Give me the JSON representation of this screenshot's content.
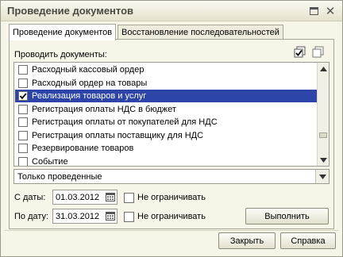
{
  "window": {
    "title": "Проведение документов"
  },
  "tabs": [
    {
      "label": "Проведение документов"
    },
    {
      "label": "Восстановление последовательностей"
    }
  ],
  "docs_label": "Проводить документы:",
  "documents": [
    {
      "label": "Расходный кассовый ордер",
      "checked": false,
      "selected": false
    },
    {
      "label": "Расходный ордер на товары",
      "checked": false,
      "selected": false
    },
    {
      "label": "Реализация товаров и услуг",
      "checked": true,
      "selected": true
    },
    {
      "label": "Регистрация оплаты НДС в бюджет",
      "checked": false,
      "selected": false
    },
    {
      "label": "Регистрация оплаты от покупателей для НДС",
      "checked": false,
      "selected": false
    },
    {
      "label": "Регистрация оплаты поставщику для НДС",
      "checked": false,
      "selected": false
    },
    {
      "label": "Резервирование товаров",
      "checked": false,
      "selected": false
    },
    {
      "label": "Событие",
      "checked": false,
      "selected": false
    }
  ],
  "filter": {
    "value": "Только проведенные"
  },
  "date_from": {
    "label": "С даты:",
    "value": "01.03.2012",
    "unlimited_label": "Не ограничивать"
  },
  "date_to": {
    "label": "По дату:",
    "value": "31.03.2012",
    "unlimited_label": "Не ограничивать"
  },
  "buttons": {
    "execute": "Выполнить",
    "close": "Закрыть",
    "help": "Справка"
  },
  "colors": {
    "selection": "#2d45a8",
    "window_bg": "#f7f4e8"
  }
}
